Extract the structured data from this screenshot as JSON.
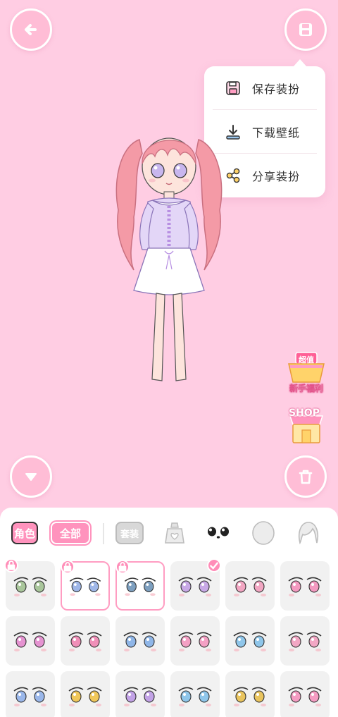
{
  "menu": {
    "items": [
      {
        "label": "保存装扮",
        "icon": "save-icon"
      },
      {
        "label": "下载壁纸",
        "icon": "download-icon"
      },
      {
        "label": "分享装扮",
        "icon": "share-icon"
      }
    ]
  },
  "buttons": {
    "back": "back-arrow-icon",
    "save": "save-icon",
    "collapse": "chevron-down-icon",
    "delete": "trash-icon"
  },
  "promos": {
    "welfare_label": "新手福利",
    "welfare_badge": "超值",
    "shop_label": "SHOP"
  },
  "tabs": {
    "role": "角色",
    "all": "全部",
    "set": "套装",
    "icons": [
      "weight-heart-icon",
      "eyes-icon",
      "face-outline-icon",
      "hair-icon"
    ]
  },
  "colors": {
    "background": "#ffcde3",
    "accent": "#ff93bd",
    "panel": "#ffffff"
  },
  "eye_options": {
    "rows": [
      [
        {
          "iris": "#a9c69b",
          "locked": true,
          "selected": false,
          "checked": false
        },
        {
          "iris": "#9fb7e8",
          "locked": true,
          "selected": true,
          "checked": false
        },
        {
          "iris": "#7d9fbf",
          "locked": true,
          "selected": true,
          "checked": false
        },
        {
          "iris": "#c8a9e6",
          "locked": false,
          "selected": false,
          "checked": true
        },
        {
          "iris": "#f2a6c2",
          "locked": false,
          "selected": false,
          "checked": false
        },
        {
          "iris": "#f39ac0",
          "locked": false,
          "selected": false,
          "checked": false
        }
      ],
      [
        {
          "iris": "#e593d1",
          "locked": false,
          "selected": false,
          "checked": false
        },
        {
          "iris": "#f08fb8",
          "locked": false,
          "selected": false,
          "checked": false
        },
        {
          "iris": "#8fb6e8",
          "locked": false,
          "selected": false,
          "checked": false
        },
        {
          "iris": "#f4a0c4",
          "locked": false,
          "selected": false,
          "checked": false
        },
        {
          "iris": "#8fc6ea",
          "locked": false,
          "selected": false,
          "checked": false
        },
        {
          "iris": "#f2a7c4",
          "locked": false,
          "selected": false,
          "checked": false
        }
      ],
      [
        {
          "iris": "#9ab7ea",
          "locked": false,
          "selected": false,
          "checked": false
        },
        {
          "iris": "#f0c75a",
          "locked": false,
          "selected": false,
          "checked": false
        },
        {
          "iris": "#c2a2e6",
          "locked": false,
          "selected": false,
          "checked": false
        },
        {
          "iris": "#8fc6ea",
          "locked": false,
          "selected": false,
          "checked": false
        },
        {
          "iris": "#e9c45e",
          "locked": false,
          "selected": false,
          "checked": false
        },
        {
          "iris": "#f49cc2",
          "locked": false,
          "selected": false,
          "checked": false
        }
      ]
    ]
  }
}
